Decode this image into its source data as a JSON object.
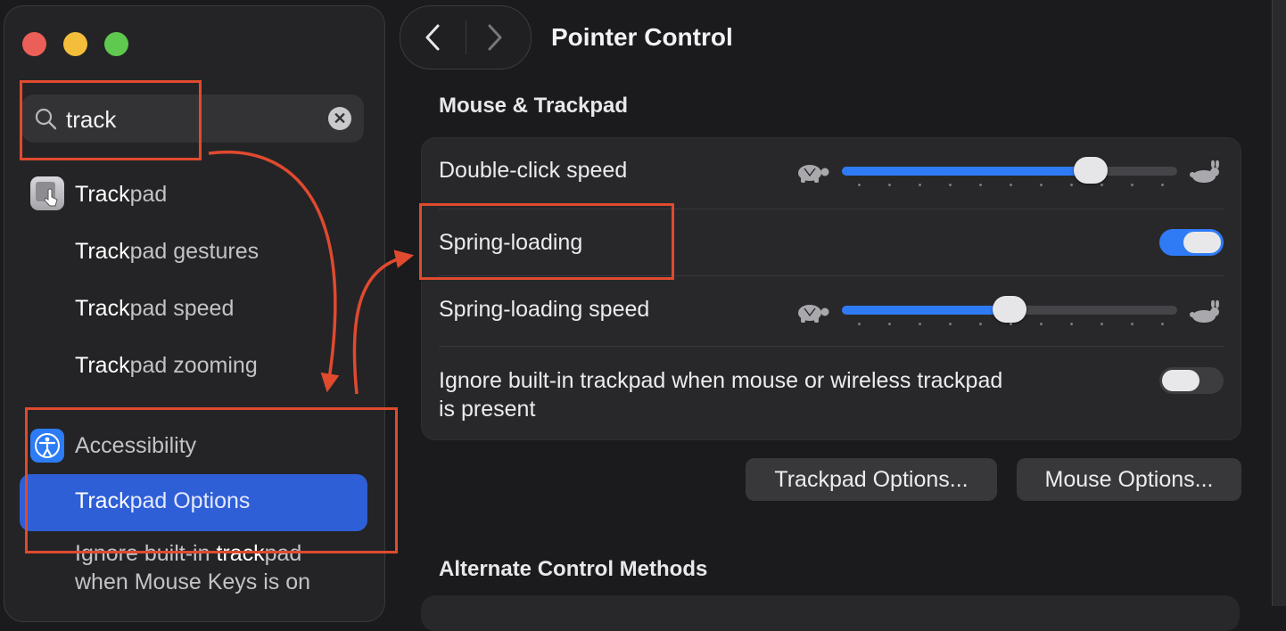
{
  "sidebar": {
    "search": {
      "query": "track"
    },
    "trackpad": {
      "prefix": "Track",
      "suffix": "pad"
    },
    "results": [
      {
        "prefix": "Track",
        "suffix": "pad gestures"
      },
      {
        "prefix": "Track",
        "suffix": "pad speed"
      },
      {
        "prefix": "Track",
        "suffix": "pad zooming"
      }
    ],
    "accessibility": "Accessibility",
    "selected": {
      "prefix": "Track",
      "suffix": "pad Options"
    },
    "ignore": {
      "line1_a": "Ignore built-in ",
      "line1_b": "track",
      "line1_c": "pad",
      "line2": "when Mouse Keys is on"
    }
  },
  "header": {
    "title": "Pointer Control"
  },
  "section1": {
    "title": "Mouse & Trackpad",
    "double_click": {
      "label": "Double-click speed",
      "value": 0.77
    },
    "spring_loading": {
      "label": "Spring-loading",
      "on": true
    },
    "spring_speed": {
      "label": "Spring-loading speed",
      "value": 0.5
    },
    "ignore": {
      "line1": "Ignore built-in trackpad when mouse or wireless trackpad",
      "line2": "is present",
      "on": false
    }
  },
  "buttons": {
    "trackpad_options": "Trackpad Options...",
    "mouse_options": "Mouse Options..."
  },
  "section2": {
    "title": "Alternate Control Methods"
  },
  "colors": {
    "accent": "#2f7bf6",
    "selection": "#2f5fd6",
    "annotation": "#e04a2f"
  }
}
